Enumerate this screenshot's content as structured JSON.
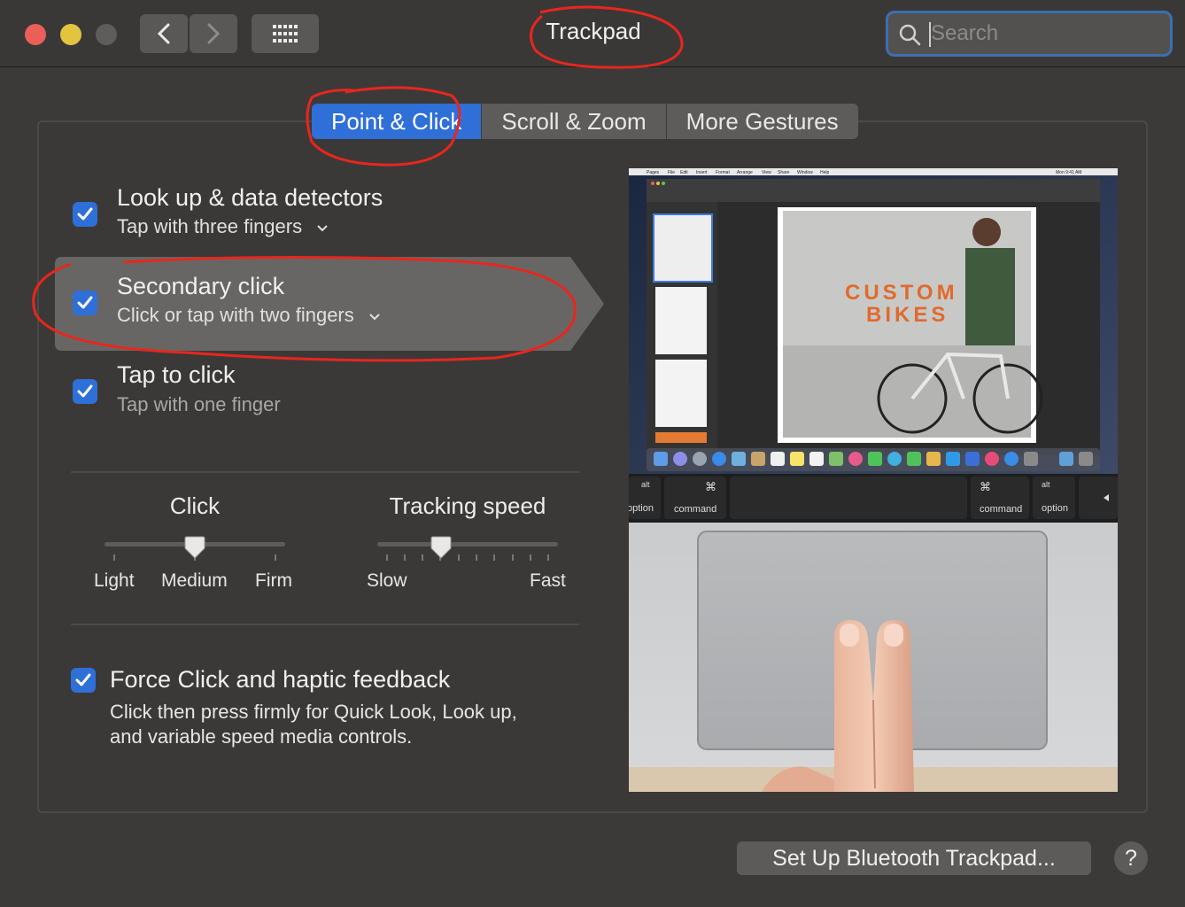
{
  "window": {
    "title": "Trackpad",
    "search_placeholder": "Search"
  },
  "tabs": [
    {
      "label": "Point & Click",
      "active": true
    },
    {
      "label": "Scroll & Zoom",
      "active": false
    },
    {
      "label": "More Gestures",
      "active": false
    }
  ],
  "options": [
    {
      "title": "Look up & data detectors",
      "subtitle": "Tap with three fingers",
      "checked": true,
      "dropdown": true
    },
    {
      "title": "Secondary click",
      "subtitle": "Click or tap with two fingers",
      "checked": true,
      "dropdown": true
    },
    {
      "title": "Tap to click",
      "subtitle": "Tap with one finger",
      "checked": true,
      "dropdown": false
    }
  ],
  "sliders": {
    "click": {
      "title": "Click",
      "labels": [
        "Light",
        "Medium",
        "Firm"
      ],
      "value": "Medium"
    },
    "tracking": {
      "title": "Tracking speed",
      "labels": [
        "Slow",
        "Fast"
      ],
      "level": 0.33
    }
  },
  "force_click": {
    "title": "Force Click and haptic feedback",
    "desc_line1": "Click then press firmly for Quick Look, Look up,",
    "desc_line2": "and variable speed media controls.",
    "checked": true
  },
  "preview": {
    "menu": [
      "Pages",
      "File",
      "Edit",
      "Insert",
      "Format",
      "Arrange",
      "View",
      "Share",
      "Window",
      "Help"
    ],
    "clock": "Mon 9:41 AM",
    "doc_title_1": "CUSTOM",
    "doc_title_2": "BIKES",
    "keys": [
      "alt",
      "option",
      "command",
      "command",
      "alt",
      "option"
    ]
  },
  "footer": {
    "bluetooth_button": "Set Up Bluetooth Trackpad...",
    "help_label": "?"
  },
  "colors": {
    "accent": "#2f6fd8",
    "annotation": "#e8261e",
    "background": "#3c3a38"
  }
}
